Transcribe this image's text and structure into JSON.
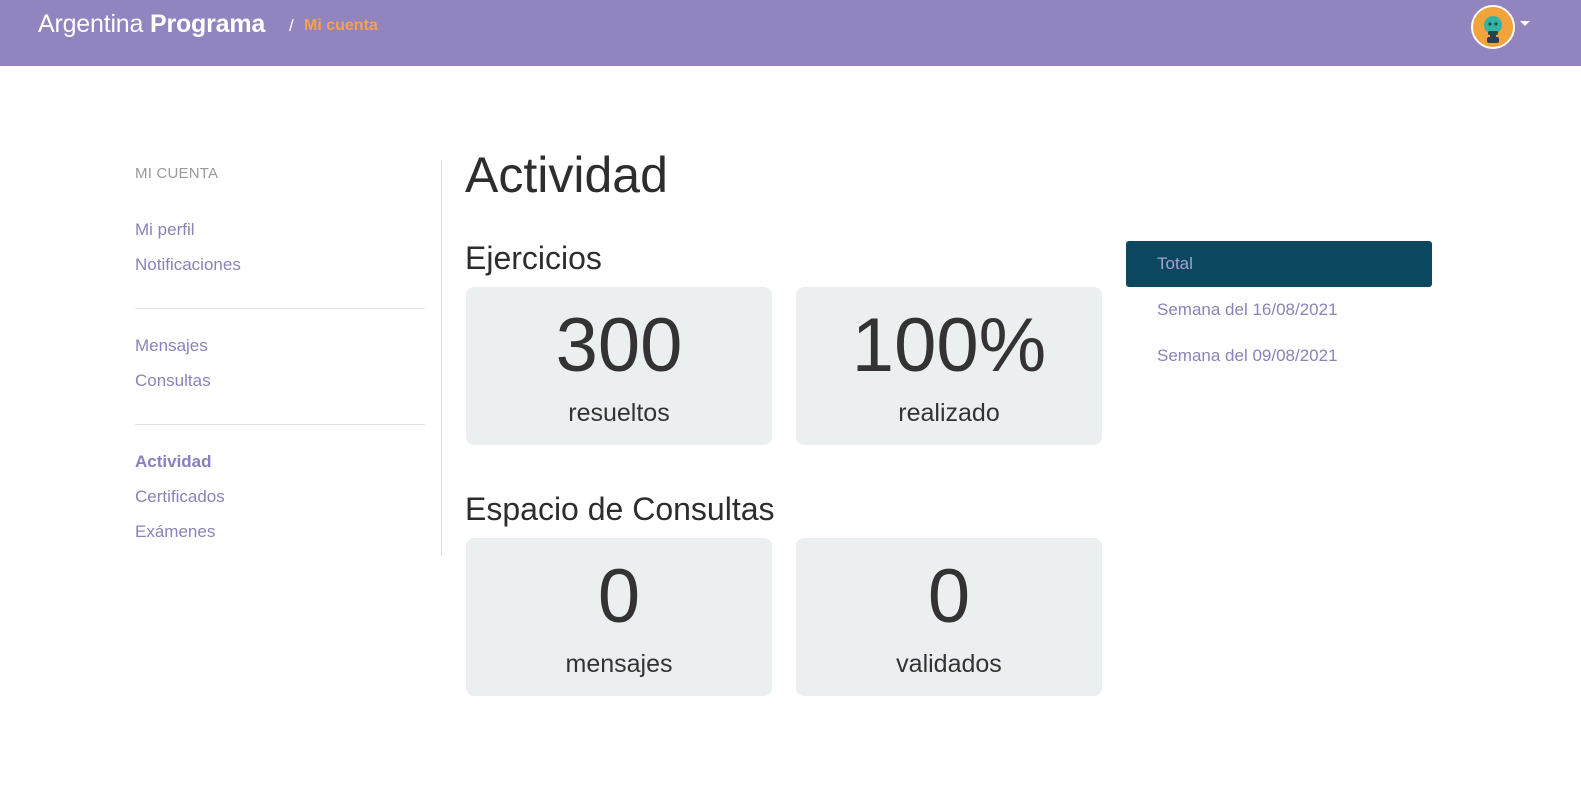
{
  "header": {
    "brand_light": "Argentina",
    "brand_bold": "Programa",
    "breadcrumb_separator": "/",
    "breadcrumb_current": "Mi cuenta",
    "avatar_icon": "robot-avatar-icon",
    "accent_color": "#f7a24a",
    "bar_color": "#9184bf"
  },
  "sidebar": {
    "heading": "MI CUENTA",
    "groups": [
      {
        "items": [
          {
            "label": "Mi perfil"
          },
          {
            "label": "Notificaciones"
          }
        ]
      },
      {
        "items": [
          {
            "label": "Mensajes"
          },
          {
            "label": "Consultas"
          }
        ]
      },
      {
        "items": [
          {
            "label": "Actividad",
            "active": true
          },
          {
            "label": "Certificados"
          },
          {
            "label": "Exámenes"
          }
        ]
      }
    ]
  },
  "main": {
    "title": "Actividad",
    "sections": [
      {
        "title": "Ejercicios",
        "stats": [
          {
            "value": "300",
            "label": "resueltos"
          },
          {
            "value": "100%",
            "label": "realizado"
          }
        ]
      },
      {
        "title": "Espacio de Consultas",
        "stats": [
          {
            "value": "0",
            "label": "mensajes"
          },
          {
            "value": "0",
            "label": "validados"
          }
        ]
      }
    ]
  },
  "periods": {
    "selected": "Total",
    "items": [
      {
        "label": "Total",
        "active": true
      },
      {
        "label": "Semana del 16/08/2021"
      },
      {
        "label": "Semana del 09/08/2021"
      }
    ],
    "active_color": "#0b475e"
  }
}
